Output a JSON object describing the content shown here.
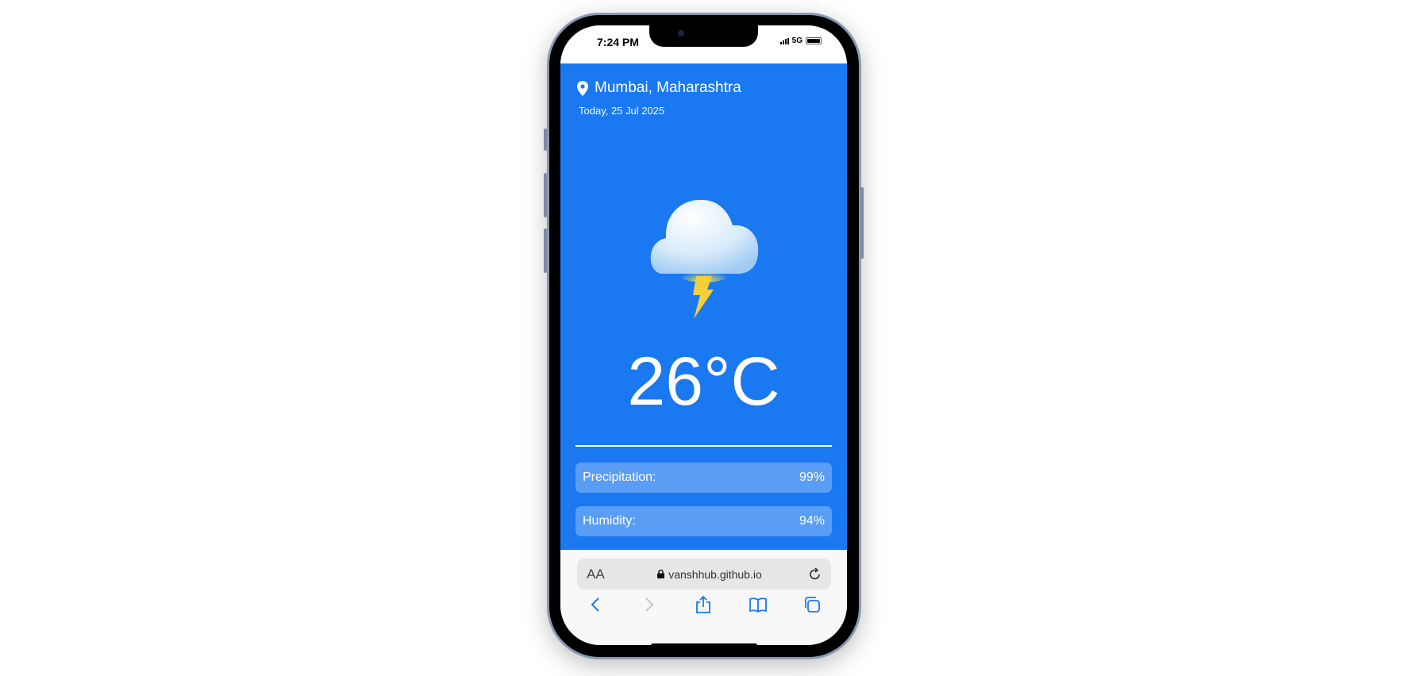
{
  "status_bar": {
    "time": "7:24 PM",
    "network": "5G"
  },
  "weather": {
    "location": "Mumbai, Maharashtra",
    "date": "Today, 25 Jul 2025",
    "temperature": "26°C",
    "condition_icon": "thunderstorm-icon",
    "stats": [
      {
        "label": "Precipitation:",
        "value": "99%"
      },
      {
        "label": "Humidity:",
        "value": "94%"
      }
    ]
  },
  "browser": {
    "text_size_label": "AA",
    "url": "vanshhub.github.io"
  },
  "colors": {
    "background": "#1a78f0",
    "safari_accent": "#1a78f0"
  }
}
